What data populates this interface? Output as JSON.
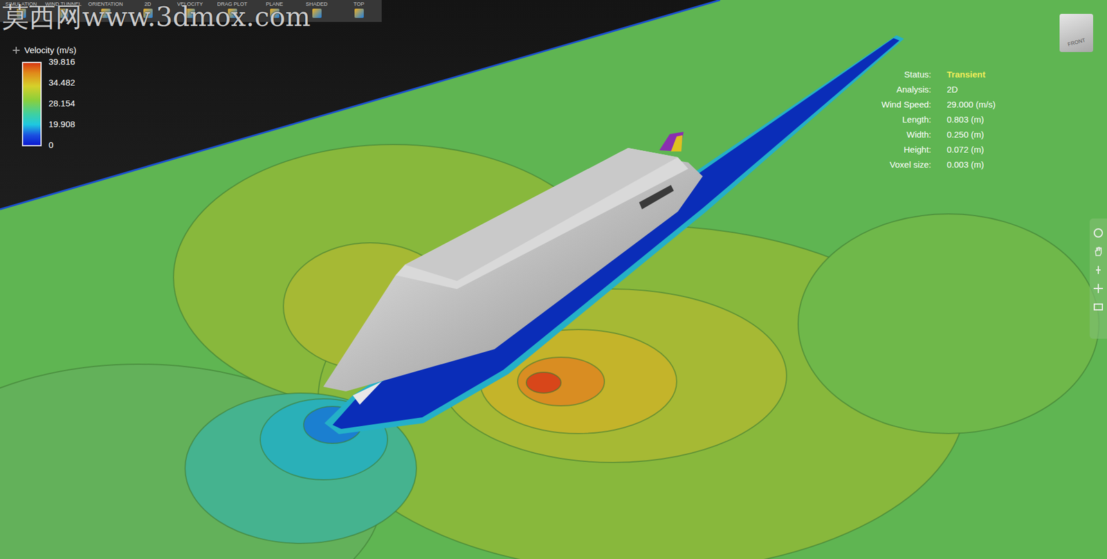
{
  "toolbar": [
    "SIMULATION",
    "WIND TUNNEL",
    "ORIENTATION",
    "2D",
    "VELOCITY",
    "DRAG PLOT",
    "PLANE",
    "SHADED",
    "TOP"
  ],
  "watermark": "莫西网www.3dmox.com",
  "legend": {
    "title": "Velocity (m/s)",
    "ticks": [
      "39.816",
      "34.482",
      "28.154",
      "19.908",
      "0"
    ]
  },
  "info": [
    {
      "label": "Status:",
      "value": "Transient",
      "highlighted": true
    },
    {
      "label": "Analysis:",
      "value": "2D",
      "highlighted": false
    },
    {
      "label": "Wind Speed:",
      "value": "29.000 (m/s)",
      "highlighted": false
    },
    {
      "label": "Length:",
      "value": "0.803 (m)",
      "highlighted": false
    },
    {
      "label": "Width:",
      "value": "0.250 (m)",
      "highlighted": false
    },
    {
      "label": "Height:",
      "value": "0.072 (m)",
      "highlighted": false
    },
    {
      "label": "Voxel size:",
      "value": "0.003 (m)",
      "highlighted": false
    }
  ],
  "view_cube": {
    "label": "FRONT"
  }
}
